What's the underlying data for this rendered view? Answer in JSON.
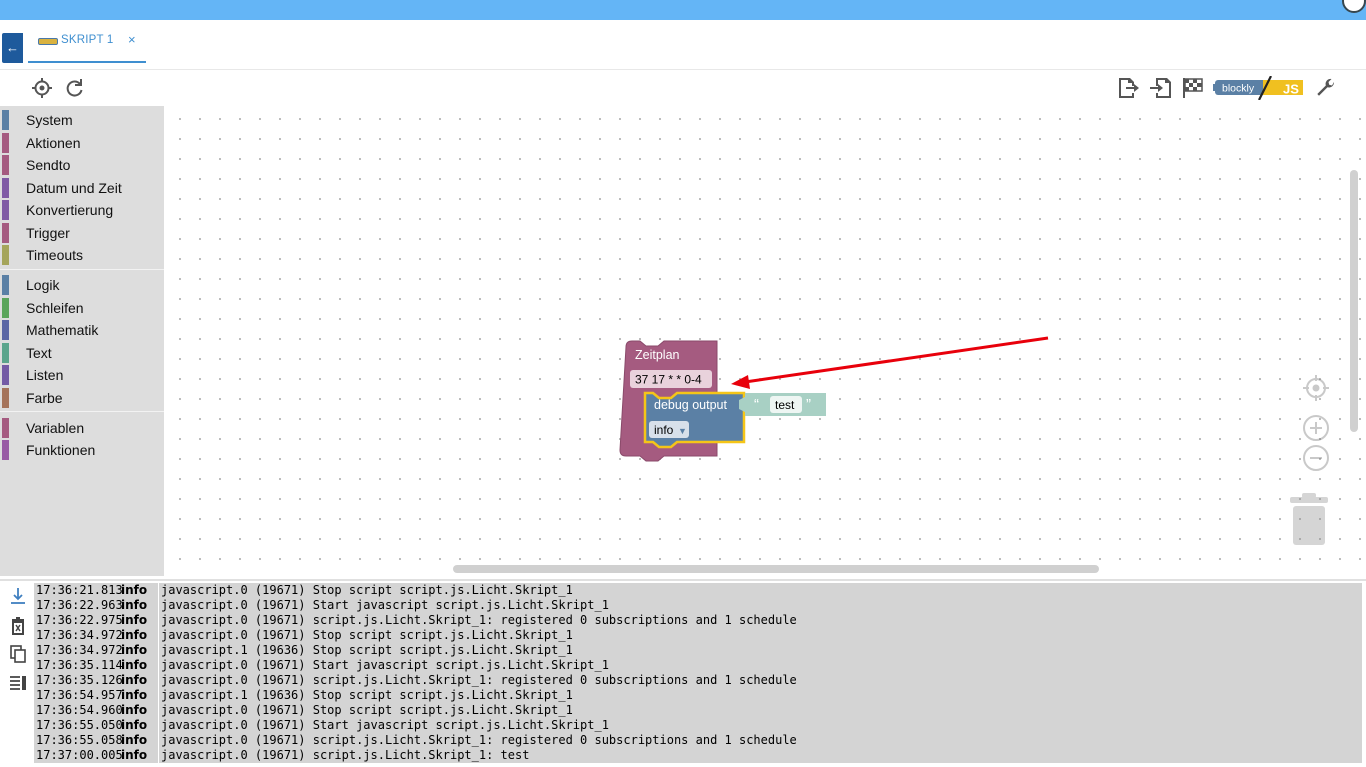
{
  "tab": {
    "label": "SKRIPT 1",
    "close": "×"
  },
  "toolbar": {
    "left_icons": [
      "locate-icon",
      "refresh-icon"
    ],
    "right_icons": [
      "export-icon",
      "import-icon",
      "checkered-flag-icon",
      "blockly-js-toggle",
      "wrench-icon"
    ],
    "blockly_label": "blockly",
    "js_label": "JS"
  },
  "toolbox": {
    "groups": [
      [
        {
          "label": "System",
          "color": "#5b80a5"
        },
        {
          "label": "Aktionen",
          "color": "#a55b80"
        },
        {
          "label": "Sendto",
          "color": "#a55b80"
        },
        {
          "label": "Datum und Zeit",
          "color": "#805ba5"
        },
        {
          "label": "Konvertierung",
          "color": "#805ba5"
        },
        {
          "label": "Trigger",
          "color": "#a55b80"
        },
        {
          "label": "Timeouts",
          "color": "#a5a55b"
        }
      ],
      [
        {
          "label": "Logik",
          "color": "#5b80a5"
        },
        {
          "label": "Schleifen",
          "color": "#5ba55b"
        },
        {
          "label": "Mathematik",
          "color": "#5b67a5"
        },
        {
          "label": "Text",
          "color": "#5ba58c"
        },
        {
          "label": "Listen",
          "color": "#745ba5"
        },
        {
          "label": "Farbe",
          "color": "#a5745b"
        }
      ],
      [
        {
          "label": "Variablen",
          "color": "#a55b80"
        },
        {
          "label": "Funktionen",
          "color": "#995ba5"
        }
      ]
    ]
  },
  "blocks": {
    "schedule": {
      "title": "Zeitplan",
      "cron": "37 17 * * 0-4",
      "color": "#a55b80"
    },
    "debug": {
      "title": "debug output",
      "level": "info",
      "color": "#5b80a5"
    },
    "text": {
      "value": "test",
      "open_quote": "“",
      "close_quote": "”",
      "color": "#5ba58c"
    }
  },
  "zoom_controls": [
    "recenter-icon",
    "zoom-in-icon",
    "zoom-out-icon",
    "trash-icon"
  ],
  "log": {
    "tools": [
      "scroll-down-icon",
      "clear-log-icon",
      "copy-icon",
      "wrap-icon"
    ],
    "rows": [
      {
        "ts": "17:36:21.813",
        "sev": "info",
        "msg": "javascript.0 (19671) Stop script script.js.Licht.Skript_1"
      },
      {
        "ts": "17:36:22.963",
        "sev": "info",
        "msg": "javascript.0 (19671) Start javascript script.js.Licht.Skript_1"
      },
      {
        "ts": "17:36:22.975",
        "sev": "info",
        "msg": "javascript.0 (19671) script.js.Licht.Skript_1: registered 0 subscriptions and 1 schedule"
      },
      {
        "ts": "17:36:34.972",
        "sev": "info",
        "msg": "javascript.0 (19671) Stop script script.js.Licht.Skript_1"
      },
      {
        "ts": "17:36:34.972",
        "sev": "info",
        "msg": "javascript.1 (19636) Stop script script.js.Licht.Skript_1"
      },
      {
        "ts": "17:36:35.114",
        "sev": "info",
        "msg": "javascript.0 (19671) Start javascript script.js.Licht.Skript_1"
      },
      {
        "ts": "17:36:35.126",
        "sev": "info",
        "msg": "javascript.0 (19671) script.js.Licht.Skript_1: registered 0 subscriptions and 1 schedule"
      },
      {
        "ts": "17:36:54.957",
        "sev": "info",
        "msg": "javascript.1 (19636) Stop script script.js.Licht.Skript_1"
      },
      {
        "ts": "17:36:54.960",
        "sev": "info",
        "msg": "javascript.0 (19671) Stop script script.js.Licht.Skript_1"
      },
      {
        "ts": "17:36:55.050",
        "sev": "info",
        "msg": "javascript.0 (19671) Start javascript script.js.Licht.Skript_1"
      },
      {
        "ts": "17:36:55.058",
        "sev": "info",
        "msg": "javascript.0 (19671) script.js.Licht.Skript_1: registered 0 subscriptions and 1 schedule"
      },
      {
        "ts": "17:37:00.005",
        "sev": "info",
        "msg": "javascript.0 (19671) script.js.Licht.Skript_1: test"
      }
    ]
  },
  "annotation_color": "#e8000b"
}
